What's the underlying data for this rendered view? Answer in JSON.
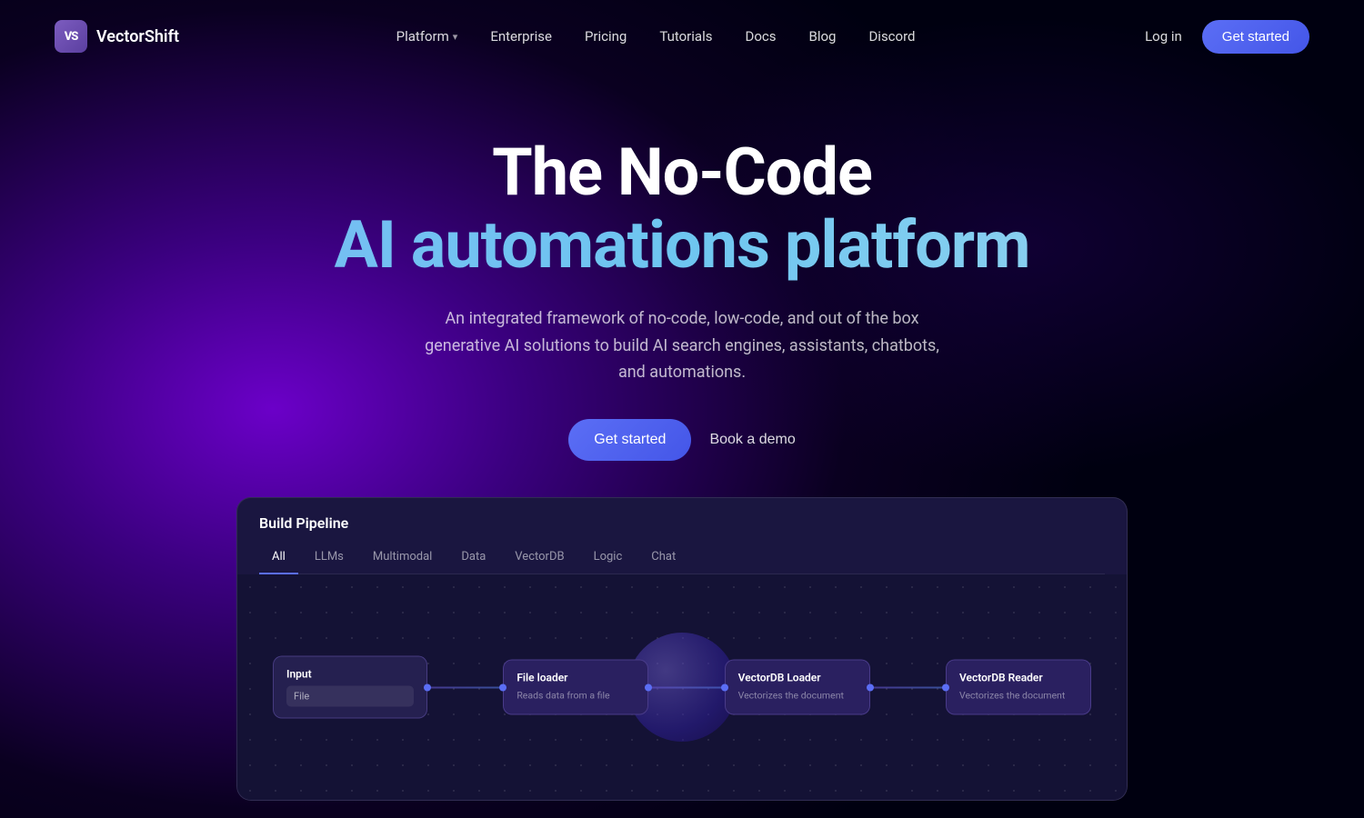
{
  "logo": {
    "initials": "VS",
    "name": "VectorShift"
  },
  "nav": {
    "platform_label": "Platform",
    "enterprise_label": "Enterprise",
    "pricing_label": "Pricing",
    "tutorials_label": "Tutorials",
    "docs_label": "Docs",
    "blog_label": "Blog",
    "discord_label": "Discord",
    "login_label": "Log in",
    "get_started_label": "Get started"
  },
  "hero": {
    "title_line1": "The No-Code",
    "title_line2": "AI automations platform",
    "subtitle": "An integrated framework of no-code, low-code, and out of the box generative AI solutions to build AI search engines, assistants, chatbots, and automations.",
    "cta_primary": "Get started",
    "cta_secondary": "Book a demo"
  },
  "pipeline": {
    "title": "Build Pipeline",
    "tabs": [
      "All",
      "LLMs",
      "Multimodal",
      "Data",
      "VectorDB",
      "Logic",
      "Chat"
    ],
    "active_tab": "All",
    "nodes": [
      {
        "title": "Input",
        "field": "File"
      },
      {
        "title": "File loader",
        "description": "Reads data from a file"
      },
      {
        "title": "VectorDB Loader",
        "description": "Vectorizes the document"
      },
      {
        "title": "VectorDB Reader",
        "description": "Vectorizes the document"
      }
    ]
  },
  "colors": {
    "accent_blue": "#5b6ef5",
    "accent_cyan": "#7ab8f5",
    "bg_dark": "#0a0020",
    "bg_purple": "#6b00c8",
    "card_bg": "#1a1640"
  }
}
